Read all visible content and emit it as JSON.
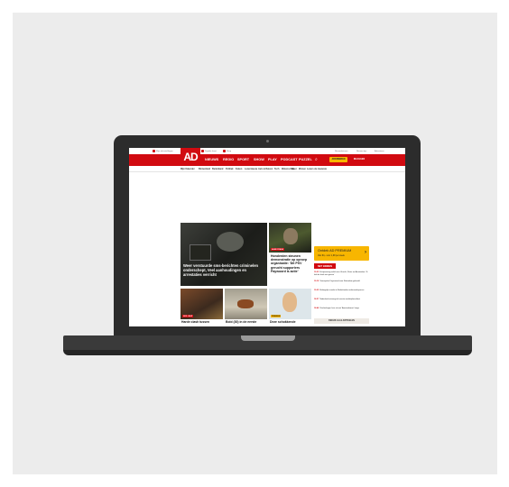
{
  "site": {
    "logo": "AD",
    "topbar": [
      "Mijn ad-instellingen",
      "TV-Gids",
      "Digitale krant",
      "Shop",
      "Nieuwsbrieven",
      "Nieuws-tips",
      "Adverteren"
    ],
    "nav": [
      "NIEUWS",
      "REGIO",
      "SPORT",
      "SHOW",
      "PLAY",
      "PODCAST",
      "PUZZEL"
    ],
    "search_icon": "search-icon",
    "premium_button": "ABONNEREN",
    "login_button": "INLOGGEN",
    "subnav": [
      "Mijn Kalender",
      "Binnenland",
      "Buitenland",
      "Politiek",
      "Koken",
      "Lezerskeuze",
      "Auto & Reizen",
      "Tech",
      "Wetenschap",
      "Weer",
      "Wonen",
      "Lezers de nieuwste"
    ]
  },
  "tiles": {
    "main_title": "Weer verstuurde sms-berichten criminelen onderschept, Veel aanhoudingen en arrestaties verricht",
    "second_tag": "ANNE FRANK",
    "second_title": "Honderden steunen demonstratie op oproep organisatie: ‘Dit PSV gerucht supporters Paywoord is actie’",
    "bottom1_tag": "NOS / ANP",
    "bottom1_title": "Harde clash tussen",
    "bottom2_title": "Bold (30) in de eerste",
    "bottom3_tag": "PREMIUM",
    "bottom3_title": "Deze schokkende"
  },
  "sidebar": {
    "premium_line1": "Ontdek AD PREMIUM",
    "premium_line2": "Van €4,- voor 1,99 per week",
    "net_binnen": "NET BINNEN",
    "news": [
      {
        "time": "19:22",
        "text": "Echtpaartrag asfalt naar Utrecht; Ruzie en Amsterdam: 'Ik heb de hoek niet gezien'"
      },
      {
        "time": "19:18",
        "text": "Teamspeler Feyenoord naar Rotterdam gehaald"
      },
      {
        "time": "19:05",
        "text": "Belangrijke vondst in Nederlandse onderzoeksproces"
      },
      {
        "time": "18:57",
        "text": "Nederland ontvangt als eerste wedstrijdresultaat"
      },
      {
        "time": "18:48",
        "text": "Vluchtelingen huis uit met 'Amsterdamse' lange"
      }
    ],
    "more_button": "BEKIJK ALLE ARTIKELEN"
  }
}
